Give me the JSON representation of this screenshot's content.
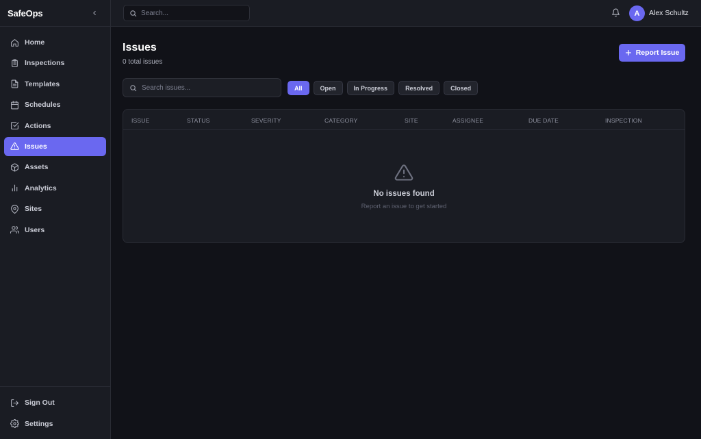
{
  "brand": "SafeOps",
  "sidebar": {
    "items": [
      {
        "label": "Home",
        "icon": "home-icon"
      },
      {
        "label": "Inspections",
        "icon": "clipboard-icon"
      },
      {
        "label": "Templates",
        "icon": "file-icon"
      },
      {
        "label": "Schedules",
        "icon": "calendar-icon"
      },
      {
        "label": "Actions",
        "icon": "check-square-icon"
      },
      {
        "label": "Issues",
        "icon": "alert-triangle-icon",
        "active": true
      },
      {
        "label": "Assets",
        "icon": "box-icon"
      },
      {
        "label": "Analytics",
        "icon": "bar-chart-icon"
      },
      {
        "label": "Sites",
        "icon": "map-pin-icon"
      },
      {
        "label": "Users",
        "icon": "users-icon"
      }
    ],
    "bottom": [
      {
        "label": "Sign Out",
        "icon": "log-out-icon"
      },
      {
        "label": "Settings",
        "icon": "gear-icon"
      }
    ]
  },
  "topbar": {
    "search_placeholder": "Search...",
    "avatar_initial": "A",
    "user_name": "Alex Schultz"
  },
  "page": {
    "title": "Issues",
    "subtitle": "0 total issues",
    "report_button": "Report Issue",
    "search_placeholder": "Search issues...",
    "filters": [
      "All",
      "Open",
      "In Progress",
      "Resolved",
      "Closed"
    ],
    "active_filter": "All"
  },
  "table": {
    "columns": [
      "ISSUE",
      "STATUS",
      "SEVERITY",
      "CATEGORY",
      "SITE",
      "ASSIGNEE",
      "DUE DATE",
      "INSPECTION"
    ],
    "rows": [],
    "empty_title": "No issues found",
    "empty_subtitle": "Report an issue to get started"
  },
  "colors": {
    "accent": "#6a68f0",
    "background": "#111218",
    "surface": "#1a1c23"
  }
}
